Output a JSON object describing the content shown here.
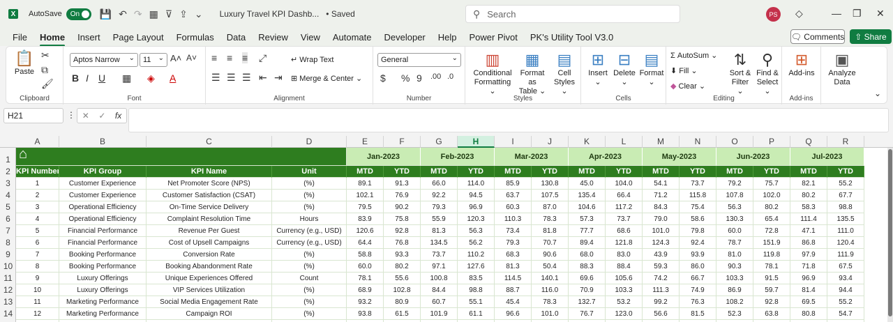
{
  "titlebar": {
    "autosave_label": "AutoSave",
    "autosave_state": "On",
    "doc_title": "Luxury Travel KPI Dashb...",
    "saved_status": "• Saved",
    "search_placeholder": "Search",
    "avatar_initials": "PS"
  },
  "menu": [
    "File",
    "Home",
    "Insert",
    "Page Layout",
    "Formulas",
    "Data",
    "Review",
    "View",
    "Automate",
    "Developer",
    "Help",
    "Power Pivot",
    "PK's Utility Tool V3.0"
  ],
  "menu_actions": {
    "comments": "Comments",
    "share": "Share"
  },
  "ribbon": {
    "clipboard": {
      "paste": "Paste",
      "label": "Clipboard"
    },
    "font": {
      "name": "Aptos Narrow",
      "size": "11",
      "label": "Font"
    },
    "alignment": {
      "wrap": "Wrap Text",
      "merge": "Merge & Center",
      "label": "Alignment"
    },
    "number": {
      "format": "General",
      "label": "Number"
    },
    "styles": {
      "cond1": "Conditional",
      "cond2": "Formatting",
      "fmt1": "Format as",
      "fmt2": "Table",
      "cell1": "Cell",
      "cell2": "Styles",
      "label": "Styles"
    },
    "cells": {
      "insert": "Insert",
      "delete": "Delete",
      "format": "Format",
      "label": "Cells"
    },
    "editing": {
      "autosum": "AutoSum",
      "fill": "Fill",
      "clear": "Clear",
      "sort1": "Sort &",
      "sort2": "Filter",
      "find1": "Find &",
      "find2": "Select",
      "label": "Editing"
    },
    "addins": {
      "addins": "Add-ins",
      "label": "Add-ins"
    },
    "analyze": {
      "line1": "Analyze",
      "line2": "Data"
    }
  },
  "namebox": "H21",
  "columns": [
    "A",
    "B",
    "C",
    "D",
    "E",
    "F",
    "G",
    "H",
    "I",
    "J",
    "K",
    "L",
    "M",
    "N",
    "O",
    "P",
    "Q",
    "R"
  ],
  "selected_column": "H",
  "rows": [
    "1",
    "2",
    "3",
    "4",
    "5",
    "6",
    "7",
    "8",
    "9",
    "10",
    "11",
    "12",
    "13",
    "14"
  ],
  "header": {
    "kpi_number": "KPI Number",
    "kpi_group": "KPI Group",
    "kpi_name": "KPI Name",
    "unit": "Unit",
    "months": [
      "Jan-2023",
      "Feb-2023",
      "Mar-2023",
      "Apr-2023",
      "May-2023",
      "Jun-2023",
      "Jul-2023"
    ],
    "mtd": "MTD",
    "ytd": "YTD"
  },
  "table": [
    [
      "1",
      "Customer Experience",
      "Net Promoter Score (NPS)",
      "(%)",
      "89.1",
      "91.3",
      "66.0",
      "114.0",
      "85.9",
      "130.8",
      "45.0",
      "104.0",
      "54.1",
      "73.7",
      "79.2",
      "75.7",
      "82.1",
      "55.2"
    ],
    [
      "2",
      "Customer Experience",
      "Customer Satisfaction (CSAT)",
      "(%)",
      "102.1",
      "76.9",
      "92.2",
      "94.5",
      "63.7",
      "107.5",
      "135.4",
      "66.4",
      "71.2",
      "115.8",
      "107.8",
      "102.0",
      "80.2",
      "67.7"
    ],
    [
      "3",
      "Operational Efficiency",
      "On-Time Service Delivery",
      "(%)",
      "79.5",
      "90.2",
      "79.3",
      "96.9",
      "60.3",
      "87.0",
      "104.6",
      "117.2",
      "84.3",
      "75.4",
      "56.3",
      "80.2",
      "58.3",
      "98.8"
    ],
    [
      "4",
      "Operational Efficiency",
      "Complaint Resolution Time",
      "Hours",
      "83.9",
      "75.8",
      "55.9",
      "120.3",
      "110.3",
      "78.3",
      "57.3",
      "73.7",
      "79.0",
      "58.6",
      "130.3",
      "65.4",
      "111.4",
      "135.5"
    ],
    [
      "5",
      "Financial Performance",
      "Revenue Per Guest",
      "Currency (e.g., USD)",
      "120.6",
      "92.8",
      "81.3",
      "56.3",
      "73.4",
      "81.8",
      "77.7",
      "68.6",
      "101.0",
      "79.8",
      "60.0",
      "72.8",
      "47.1",
      "111.0"
    ],
    [
      "6",
      "Financial Performance",
      "Cost of Upsell Campaigns",
      "Currency (e.g., USD)",
      "64.4",
      "76.8",
      "134.5",
      "56.2",
      "79.3",
      "70.7",
      "89.4",
      "121.8",
      "124.3",
      "92.4",
      "78.7",
      "151.9",
      "86.8",
      "120.4"
    ],
    [
      "7",
      "Booking Performance",
      "Conversion Rate",
      "(%)",
      "58.8",
      "93.3",
      "73.7",
      "110.2",
      "68.3",
      "90.6",
      "68.0",
      "83.0",
      "43.9",
      "93.9",
      "81.0",
      "119.8",
      "97.9",
      "111.9"
    ],
    [
      "8",
      "Booking Performance",
      "Booking Abandonment Rate",
      "(%)",
      "60.0",
      "80.2",
      "97.1",
      "127.6",
      "81.3",
      "50.4",
      "88.3",
      "88.4",
      "59.3",
      "86.0",
      "90.3",
      "78.1",
      "71.8",
      "67.5"
    ],
    [
      "9",
      "Luxury Offerings",
      "Unique Experiences Offered",
      "Count",
      "78.1",
      "55.6",
      "100.8",
      "83.5",
      "114.5",
      "140.1",
      "69.6",
      "105.6",
      "74.2",
      "66.7",
      "103.3",
      "91.5",
      "96.9",
      "93.4"
    ],
    [
      "10",
      "Luxury Offerings",
      "VIP Services Utilization",
      "(%)",
      "68.9",
      "102.8",
      "84.4",
      "98.8",
      "88.7",
      "116.0",
      "70.9",
      "103.3",
      "111.3",
      "74.9",
      "86.9",
      "59.7",
      "81.4",
      "94.4"
    ],
    [
      "11",
      "Marketing Performance",
      "Social Media Engagement Rate",
      "(%)",
      "93.2",
      "80.9",
      "60.7",
      "55.1",
      "45.4",
      "78.3",
      "132.7",
      "53.2",
      "99.2",
      "76.3",
      "108.2",
      "92.8",
      "69.5",
      "55.2"
    ],
    [
      "12",
      "Marketing Performance",
      "Campaign ROI",
      "(%)",
      "93.8",
      "61.5",
      "101.9",
      "61.1",
      "96.6",
      "101.0",
      "76.7",
      "123.0",
      "56.6",
      "81.5",
      "52.3",
      "63.8",
      "80.8",
      "54.7"
    ]
  ]
}
